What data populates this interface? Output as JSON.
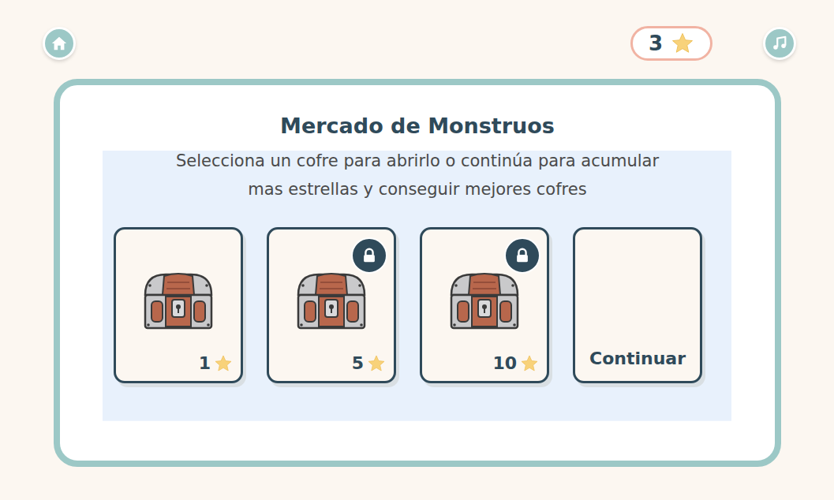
{
  "header": {
    "stars": "3"
  },
  "market": {
    "title": "Mercado de Monstruos",
    "subtitle_lines": [
      "Selecciona un cofre para abrirlo o continúa para acumular",
      "mas estrellas y conseguir mejores cofres"
    ]
  },
  "options": [
    {
      "kind": "chest",
      "cost": "1",
      "locked": false
    },
    {
      "kind": "chest",
      "cost": "5",
      "locked": true
    },
    {
      "kind": "chest",
      "cost": "10",
      "locked": true
    },
    {
      "kind": "continue",
      "label": "Continuar"
    }
  ]
}
